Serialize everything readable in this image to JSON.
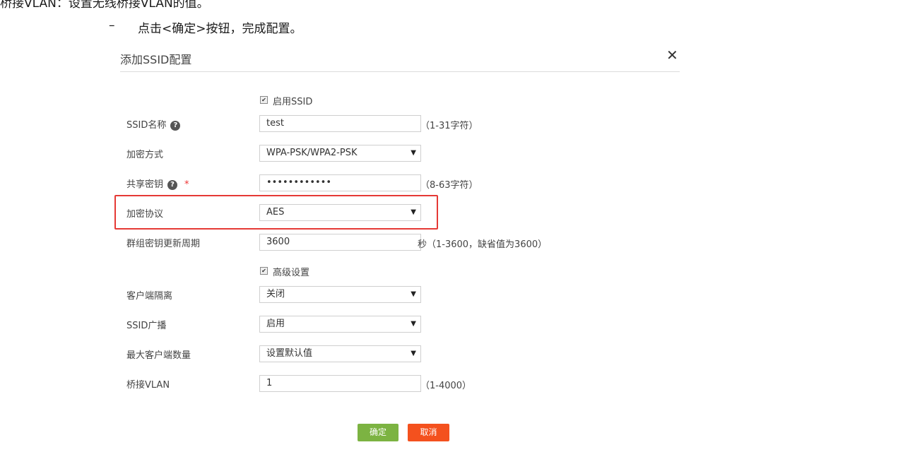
{
  "doc": {
    "line_top": "桥接VLAN：设置无线桥接VLAN的值。",
    "bullet": "–",
    "line_step": "点击<确定>按钮，完成配置。"
  },
  "dialog": {
    "title": "添加SSID配置",
    "close_label": "✕",
    "enable_ssid_label": "启用SSID",
    "ssid_name": {
      "label": "SSID名称",
      "value": "test",
      "hint": "（1-31字符）"
    },
    "encrypt_mode": {
      "label": "加密方式",
      "value": "WPA-PSK/WPA2-PSK"
    },
    "shared_key": {
      "label": "共享密钥",
      "required_mark": "*",
      "value": "••••••••••••",
      "hint": "（8-63字符）"
    },
    "encrypt_protocol": {
      "label": "加密协议",
      "value": "AES"
    },
    "group_key_period": {
      "label": "群组密钥更新周期",
      "value": "3600",
      "hint": "秒（1-3600，缺省值为3600）"
    },
    "advanced_label": "高级设置",
    "client_isolation": {
      "label": "客户端隔离",
      "value": "关闭"
    },
    "ssid_broadcast": {
      "label": "SSID广播",
      "value": "启用"
    },
    "max_clients": {
      "label": "最大客户端数量",
      "value": "设置默认值"
    },
    "bridge_vlan": {
      "label": "桥接VLAN",
      "value": "1",
      "hint": "（1-4000）"
    },
    "ok_label": "确定",
    "cancel_label": "取消"
  },
  "icons": {
    "help": "question-circle-icon",
    "caret": "caret-down-icon",
    "check": "checkbox-checked-icon"
  },
  "colors": {
    "highlight": "#e53935",
    "ok": "#7cb342",
    "cancel": "#f4511e"
  }
}
